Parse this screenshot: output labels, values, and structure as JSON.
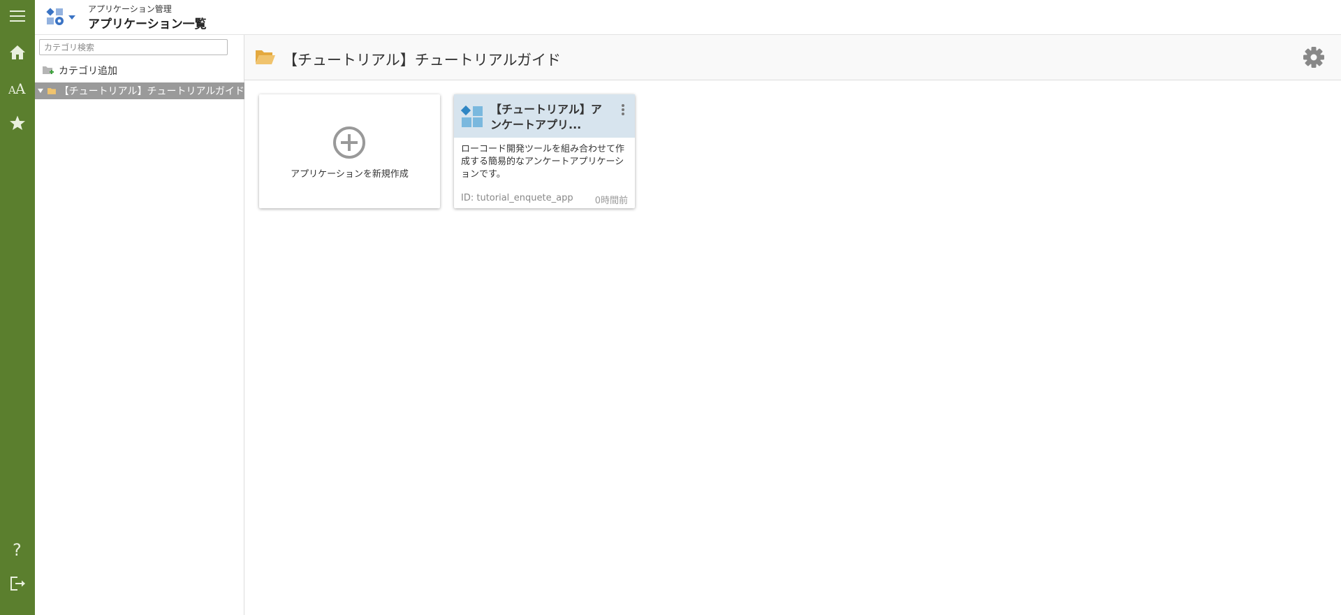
{
  "header": {
    "subtitle": "アプリケーション管理",
    "title": "アプリケーション一覧"
  },
  "rail": {
    "icons": [
      "menu-icon",
      "home-icon",
      "font-size-icon",
      "star-icon",
      "help-icon",
      "logout-icon"
    ]
  },
  "tree": {
    "search_placeholder": "カテゴリ検索",
    "add_label": "カテゴリ追加",
    "nodes": [
      {
        "label": "【チュートリアル】チュートリアルガイド",
        "expanded": true,
        "selected": true
      }
    ]
  },
  "main": {
    "title": "【チュートリアル】チュートリアルガイド",
    "new_app_label": "アプリケーションを新規作成",
    "apps": [
      {
        "name": "【チュートリアル】アンケートアプリ...",
        "description": "ローコード開発ツールを組み合わせて作成する簡易的なアンケートアプリケーションです。",
        "id_text": "ID: tutorial_enquete_app",
        "time": "0時間前"
      }
    ]
  },
  "colors": {
    "rail": "#5b7f2e",
    "card_header": "#d7e4ee",
    "tree_selected": "#9a9a9a",
    "folder": "#f0c36d"
  }
}
